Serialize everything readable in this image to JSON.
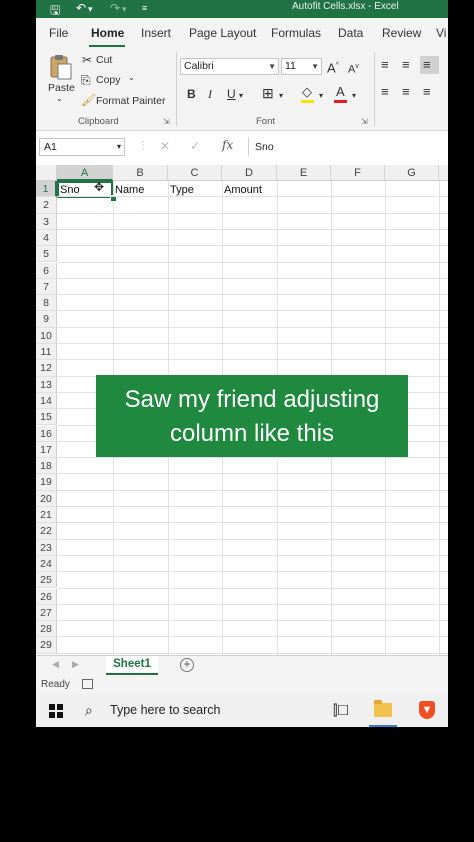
{
  "window": {
    "title": "Autofit Cells.xlsx  -  Excel"
  },
  "quick_access": {
    "save_icon": "save-icon",
    "undo_icon": "undo-icon",
    "redo_icon": "redo-icon",
    "customize_icon": "customize-qat-icon"
  },
  "tabs": [
    {
      "label": "File"
    },
    {
      "label": "Home"
    },
    {
      "label": "Insert"
    },
    {
      "label": "Page Layout"
    },
    {
      "label": "Formulas"
    },
    {
      "label": "Data"
    },
    {
      "label": "Review"
    },
    {
      "label": "Vi"
    }
  ],
  "ribbon": {
    "clipboard": {
      "paste_label": "Paste",
      "cut_label": "Cut",
      "copy_label": "Copy",
      "format_painter_label": "Format Painter",
      "group_label": "Clipboard"
    },
    "font": {
      "font_name": "Calibri",
      "font_size": "11",
      "grow_label": "A",
      "shrink_label": "A",
      "bold_label": "B",
      "italic_label": "I",
      "underline_label": "U",
      "font_color_label": "A",
      "group_label": "Font"
    }
  },
  "formula_bar": {
    "name_box": "A1",
    "cancel": "✕",
    "enter": "✓",
    "fx": "fx",
    "content": "Sno"
  },
  "columns": [
    "A",
    "B",
    "C",
    "D",
    "E",
    "F",
    "G"
  ],
  "rows": [
    "1",
    "2",
    "3",
    "4",
    "5",
    "6",
    "7",
    "8",
    "9",
    "10",
    "11",
    "12",
    "13",
    "14",
    "15",
    "16",
    "17",
    "18",
    "19",
    "20",
    "21",
    "22",
    "23",
    "24",
    "25",
    "26",
    "27",
    "28",
    "29"
  ],
  "cells": {
    "A1": "Sno",
    "B1": "Name",
    "C1": "Type",
    "D1": "Amount"
  },
  "banner": {
    "line1": "Saw my friend adjusting",
    "line2": "column like this"
  },
  "sheets": [
    {
      "label": "Sheet1"
    }
  ],
  "add_sheet": "+",
  "status": {
    "text": "Ready"
  },
  "taskbar": {
    "search_placeholder": "Type here to search"
  },
  "colors": {
    "excel_green": "#217346",
    "banner_green": "#1f8a3f"
  }
}
